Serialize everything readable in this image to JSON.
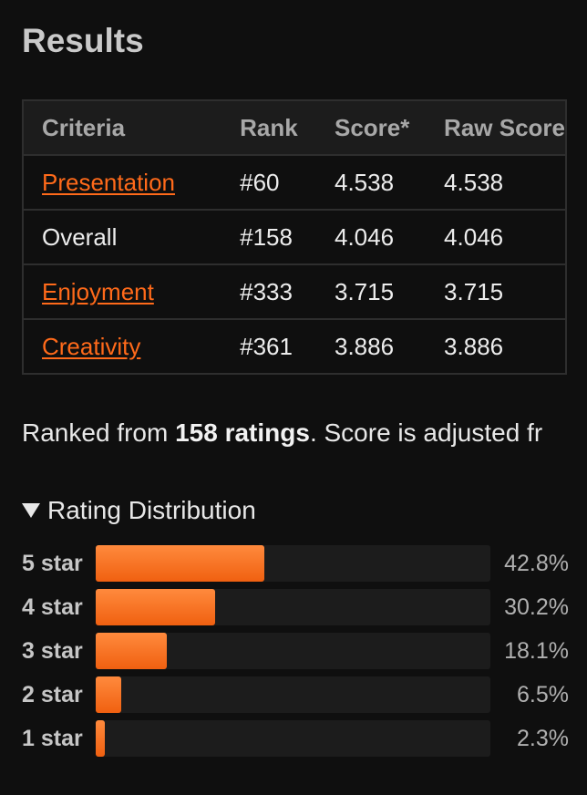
{
  "results": {
    "title": "Results",
    "headers": {
      "criteria": "Criteria",
      "rank": "Rank",
      "score": "Score*",
      "raw_score": "Raw Score"
    },
    "rows": [
      {
        "criteria": "Presentation",
        "rank": "#60",
        "score": "4.538",
        "raw_score": "4.538"
      },
      {
        "criteria": "Overall",
        "rank": "#158",
        "score": "4.046",
        "raw_score": "4.046"
      },
      {
        "criteria": "Enjoyment",
        "rank": "#333",
        "score": "3.715",
        "raw_score": "3.715"
      },
      {
        "criteria": "Creativity",
        "rank": "#361",
        "score": "3.886",
        "raw_score": "3.886"
      }
    ]
  },
  "summary": {
    "prefix": "Ranked from ",
    "ratings": "158 ratings",
    "suffix": ". Score is adjusted fr"
  },
  "distribution": {
    "toggle_label": "Rating Distribution",
    "rows": [
      {
        "label": "5 star",
        "percent_text": "42.8%",
        "fraction": 0.428
      },
      {
        "label": "4 star",
        "percent_text": "30.2%",
        "fraction": 0.302
      },
      {
        "label": "3 star",
        "percent_text": "18.1%",
        "fraction": 0.181
      },
      {
        "label": "2 star",
        "percent_text": "6.5%",
        "fraction": 0.065
      },
      {
        "label": "1 star",
        "percent_text": "2.3%",
        "fraction": 0.023
      }
    ]
  },
  "colors": {
    "accent": "#ff6a1a",
    "background": "#0f0f0f",
    "track": "#1c1c1c"
  }
}
